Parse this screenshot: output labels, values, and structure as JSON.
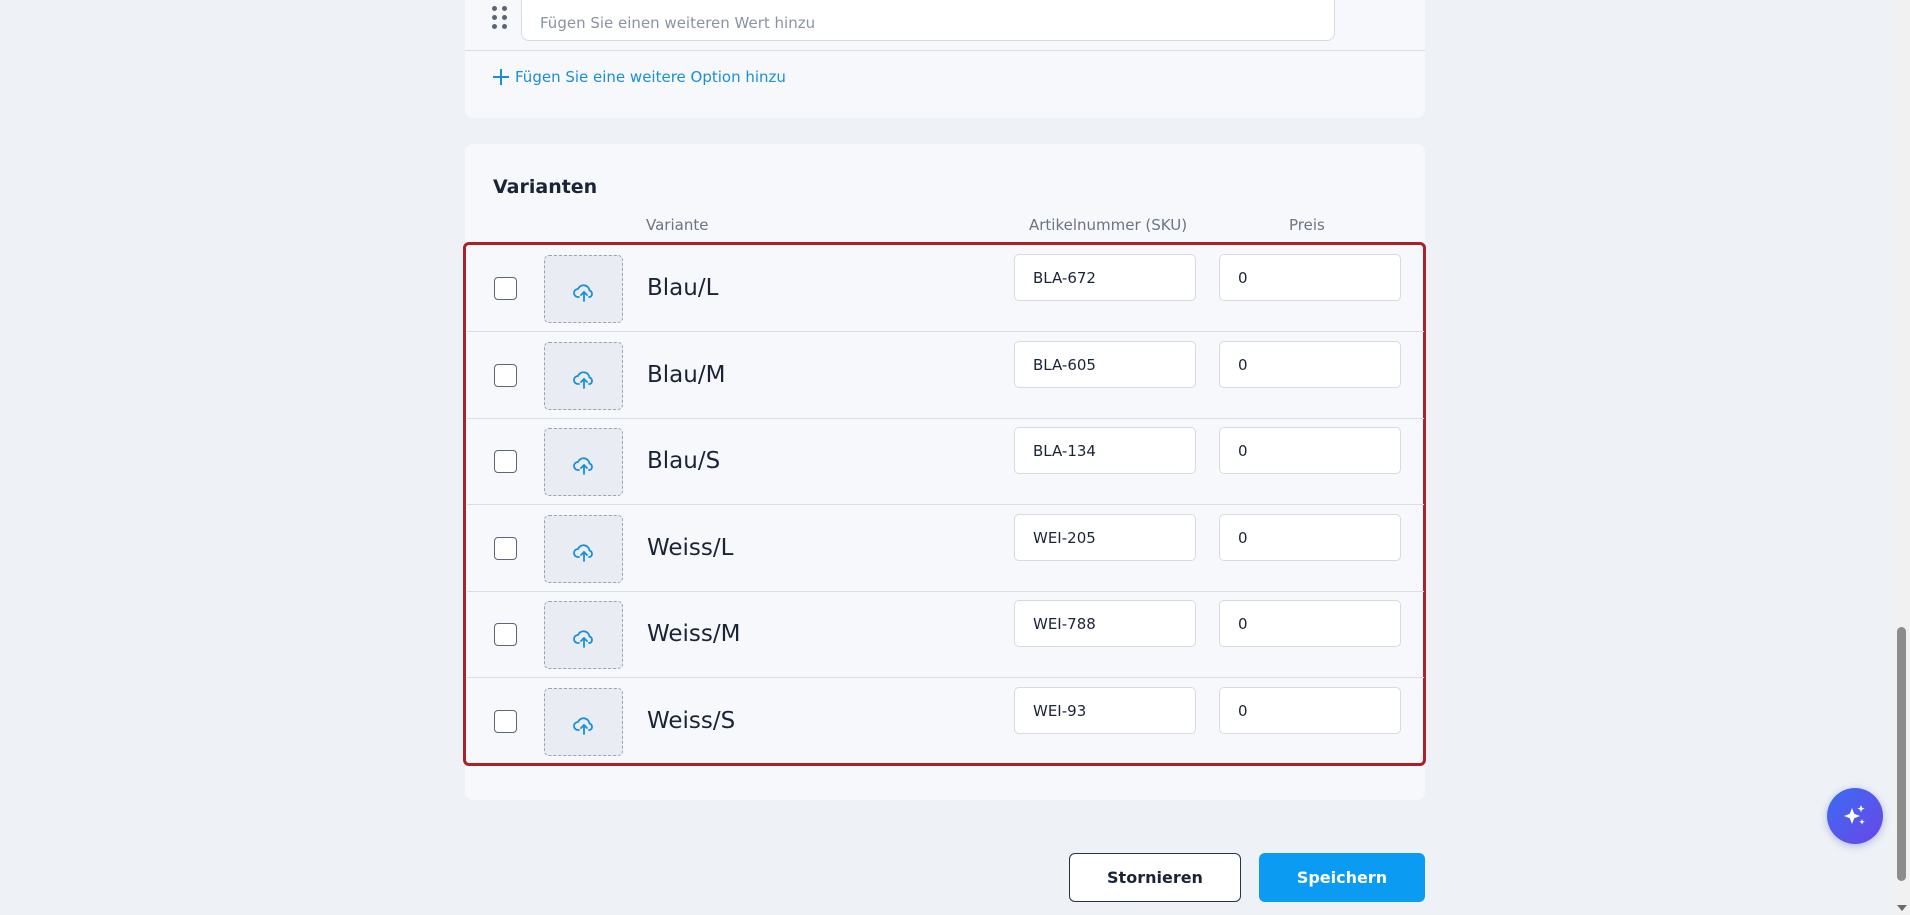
{
  "options": {
    "value_placeholder": "Fügen Sie einen weiteren Wert hinzu",
    "add_option_label": "Fügen Sie eine weitere Option hinzu"
  },
  "variants": {
    "title": "Varianten",
    "columns": {
      "variant": "Variante",
      "sku": "Artikelnummer (SKU)",
      "price": "Preis"
    },
    "rows": [
      {
        "name": "Blau/L",
        "sku": "BLA-672",
        "price": "0",
        "checked": false
      },
      {
        "name": "Blau/M",
        "sku": "BLA-605",
        "price": "0",
        "checked": false
      },
      {
        "name": "Blau/S",
        "sku": "BLA-134",
        "price": "0",
        "checked": false
      },
      {
        "name": "Weiss/L",
        "sku": "WEI-205",
        "price": "0",
        "checked": false
      },
      {
        "name": "Weiss/M",
        "sku": "WEI-788",
        "price": "0",
        "checked": false
      },
      {
        "name": "Weiss/S",
        "sku": "WEI-93",
        "price": "0",
        "checked": false
      }
    ]
  },
  "footer": {
    "cancel_label": "Stornieren",
    "save_label": "Speichern"
  },
  "icons": {
    "upload": "cloud-upload-icon",
    "drag": "drag-handle-icon",
    "plus": "plus-icon",
    "assistant": "sparkles-icon"
  },
  "colors": {
    "accent": "#0b9bf2",
    "link": "#1a8fd6",
    "highlight_border": "#a8222a",
    "assistant_gradient_start": "#3b6cf3",
    "assistant_gradient_end": "#6a46e6"
  }
}
